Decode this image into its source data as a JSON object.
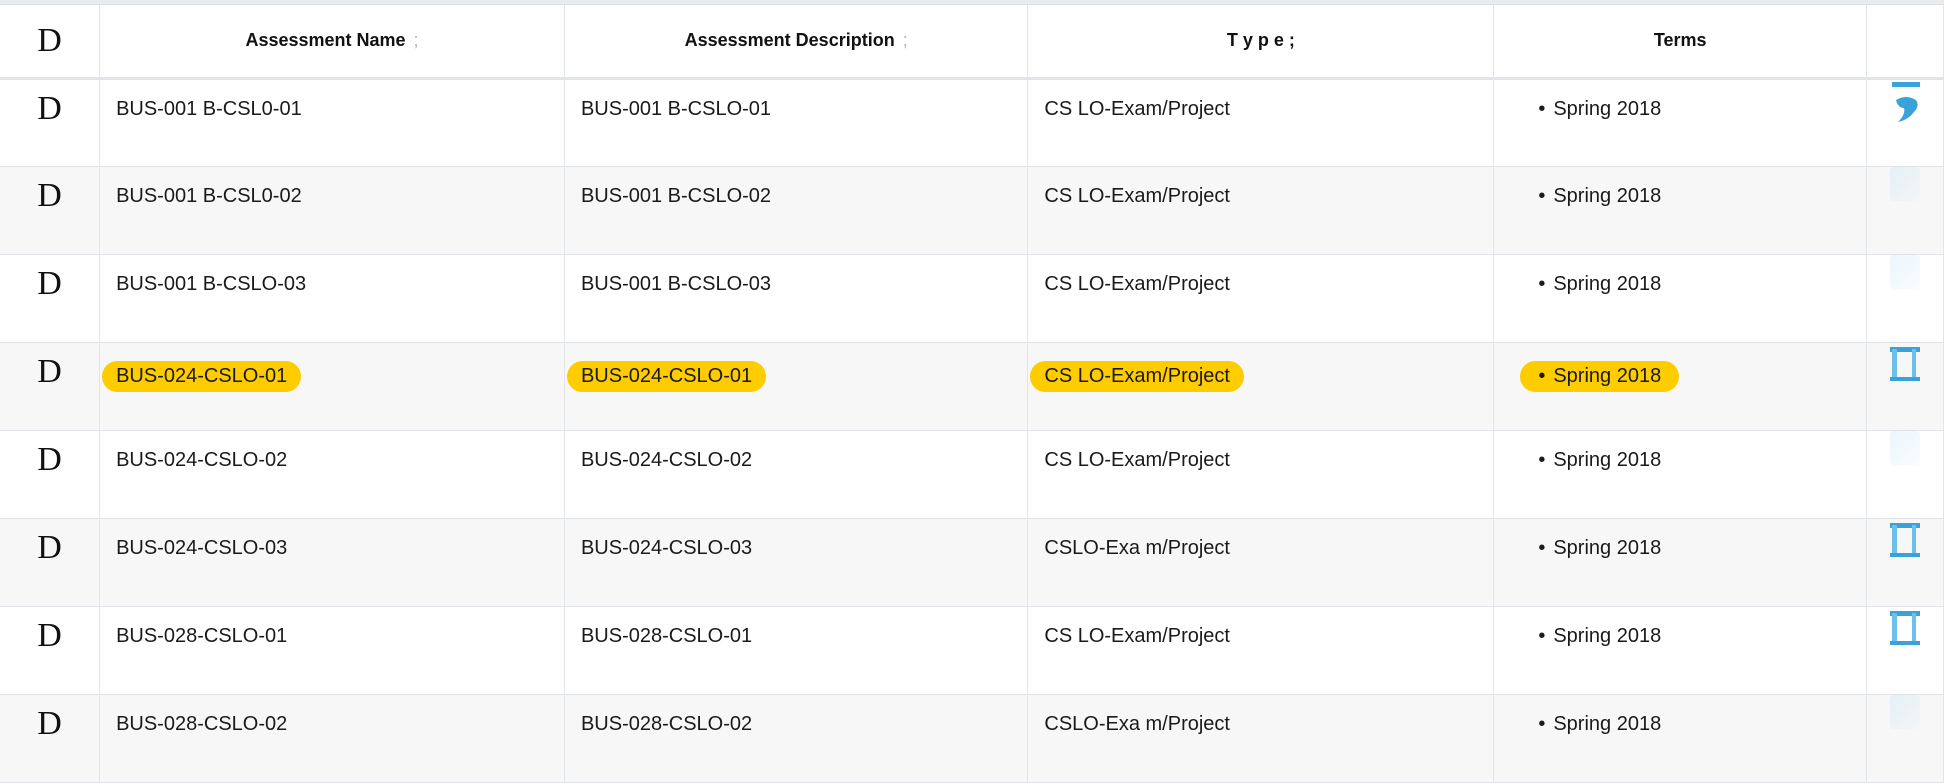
{
  "table": {
    "select_header": "D",
    "columns": [
      {
        "label": "Assessment Name",
        "sort": ";"
      },
      {
        "label": "Assessment Description",
        "sort": ";"
      },
      {
        "label": "T y p e ;",
        "sort": ""
      },
      {
        "label": "Terms",
        "sort": ""
      }
    ],
    "rows": [
      {
        "select": "D",
        "name": "BUS-001 B-CSL0-01",
        "description": "BUS-001 B-CSLO-01",
        "type": "CS LO-Exam/Project",
        "term": "Spring  2018",
        "highlighted": false,
        "action_icon": "comment-icon"
      },
      {
        "select": "D",
        "name": "BUS-001 B-CSL0-02",
        "description": "BUS-001 B-CSLO-02",
        "type": "CS LO-Exam/Project",
        "term": "Spring  2018",
        "highlighted": false,
        "action_icon": "faded-icon"
      },
      {
        "select": "D",
        "name": "BUS-001 B-CSLO-03",
        "description": "BUS-001 B-CSLO-03",
        "type": "CS LO-Exam/Project",
        "term": "Spring  2018",
        "highlighted": false,
        "action_icon": "faded-icon"
      },
      {
        "select": "D",
        "name": "BUS-024-CSLO-01",
        "description": "BUS-024-CSLO-01",
        "type": "CS LO-Exam/Project",
        "term": "Spring  2018",
        "highlighted": true,
        "action_icon": "document-icon"
      },
      {
        "select": "D",
        "name": "BUS-024-CSLO-02",
        "description": "BUS-024-CSLO-02",
        "type": "CS LO-Exam/Project",
        "term": "Spring  2018",
        "highlighted": false,
        "action_icon": "faded-icon"
      },
      {
        "select": "D",
        "name": "BUS-024-CSLO-03",
        "description": "BUS-024-CSLO-03",
        "type": "CSLO-Exa m/Project",
        "term": "Spring  2018",
        "highlighted": false,
        "action_icon": "document-icon"
      },
      {
        "select": "D",
        "name": "BUS-028-CSLO-01",
        "description": "BUS-028-CSLO-01",
        "type": "CS LO-Exam/Project",
        "term": "Spring  2018",
        "highlighted": false,
        "action_icon": "document-icon"
      },
      {
        "select": "D",
        "name": "BUS-028-CSLO-02",
        "description": "BUS-028-CSLO-02",
        "type": "CSLO-Exa m/Project",
        "term": "Spring  2018",
        "highlighted": false,
        "action_icon": "faded-icon"
      }
    ],
    "bullet": "•"
  },
  "colors": {
    "highlight": "#ffcc00",
    "icon_blue": "#3aa2d9",
    "row_alt": "#f7f7f7"
  }
}
